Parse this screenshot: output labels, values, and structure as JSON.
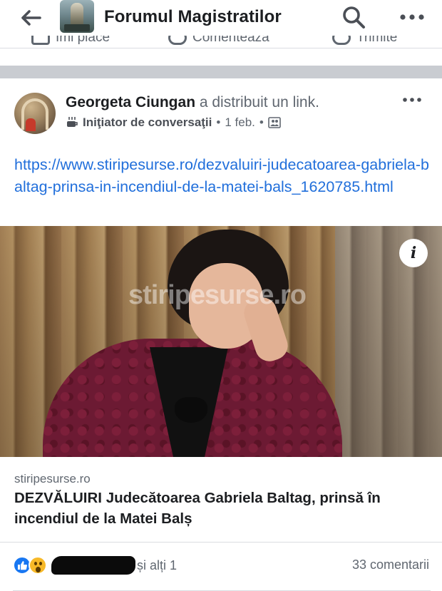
{
  "header": {
    "back_label": "Back",
    "group_title": "Forumul Magistratilor",
    "search_icon": "search-icon",
    "more_icon": "more-icon"
  },
  "action_bar": {
    "like": "Îmi place",
    "comment": "Comentează",
    "share": "Trimite"
  },
  "post": {
    "author": "Georgeta Ciungan",
    "action_text": " a distribuit un link.",
    "badge": "Iniţiator de conversaţii",
    "time": "1 feb.",
    "audience_icon": "group-audience-icon",
    "link_url": "https://www.stiripesurse.ro/dezvaluiri-judecatoarea-gabriela-baltag-prinsa-in-incendiul-de-la-matei-bals_1620785.html",
    "preview": {
      "watermark": "stiripesurse.ro",
      "info_label": "i",
      "domain": "stiripesurse.ro",
      "headline": "DEZVĂLUIRI Judecătoarea Gabriela Baltag, prinsă în incendiul de la Matei Balș"
    },
    "reactions": {
      "others_text": "și alți 1",
      "comments_text": "33 comentarii"
    }
  },
  "colors": {
    "link": "#216fdb",
    "like_blue": "#1877f2",
    "wow_yellow": "#f7b928",
    "separator": "#c9ccd1"
  }
}
